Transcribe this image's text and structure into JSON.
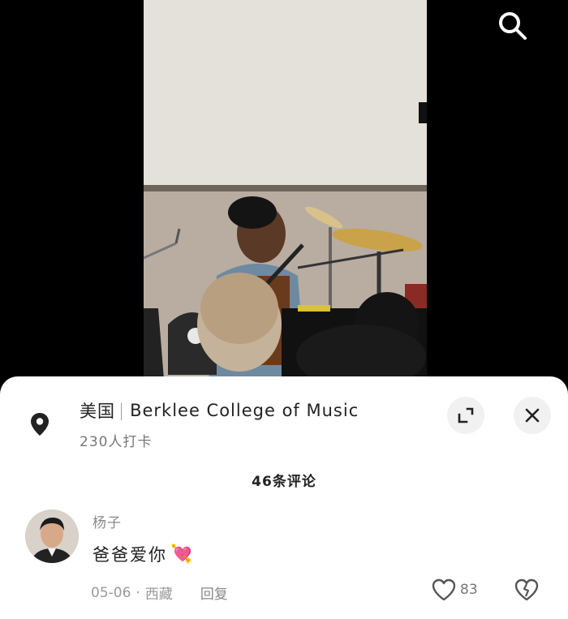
{
  "location": {
    "country": "美国",
    "place_name": "Berklee College of Music",
    "checkins": "230人打卡"
  },
  "comments_header": "46条评论",
  "comment": {
    "username": "杨子",
    "text": "爸爸爱你",
    "emoji": "💘",
    "date": "05-06",
    "region": "西藏",
    "reply_label": "回复",
    "like_count": "83"
  },
  "icons": {
    "search": "search-icon",
    "location": "location-pin-icon",
    "expand": "expand-icon",
    "close": "close-icon",
    "like": "heart-outline-icon",
    "dislike": "broken-heart-icon",
    "emoji": "heart-hands-emoji"
  },
  "colors": {
    "sheet_background": "#ffffff",
    "primary_text": "#222222",
    "secondary_text": "#8a8a8a",
    "button_background": "#f1f1f1",
    "page_background": "#000000"
  }
}
